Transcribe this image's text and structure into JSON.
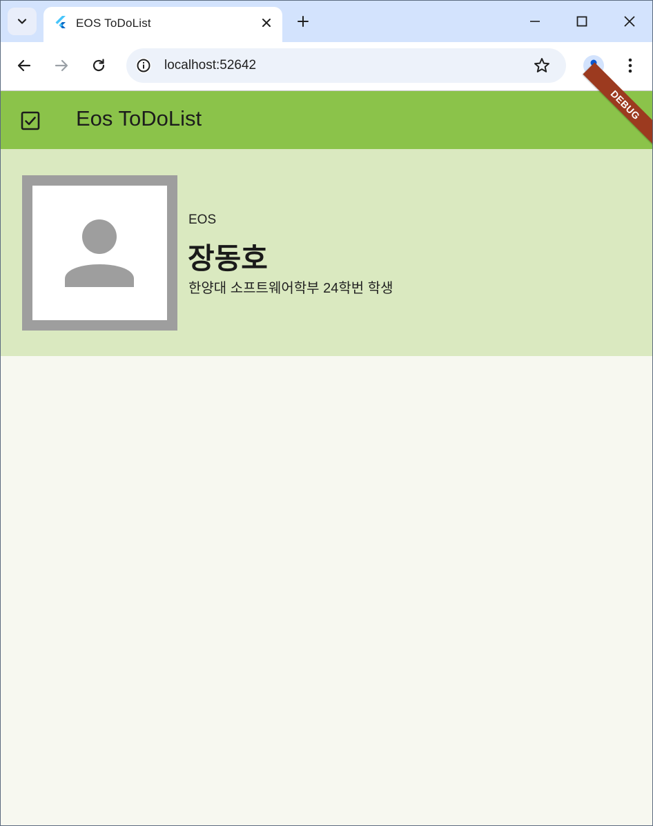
{
  "browser": {
    "tab_title": "EOS ToDoList",
    "url": "localhost:52642",
    "icons": {
      "tab_search": "chevron-down-icon",
      "favicon": "flutter-icon",
      "tab_close": "close-icon",
      "new_tab": "plus-icon",
      "minimize": "minimize-icon",
      "maximize": "maximize-icon",
      "window_close": "close-icon",
      "back": "arrow-back-icon",
      "forward": "arrow-forward-icon",
      "reload": "reload-icon",
      "site_info": "info-icon",
      "bookmark": "star-icon",
      "profile": "person-icon",
      "menu": "more-vert-icon"
    },
    "colors": {
      "tabstrip": "#d3e3fd",
      "omnibox": "#edf2fa"
    }
  },
  "app": {
    "title": "Eos ToDoList",
    "leading_icon": "check-box-icon",
    "debug_banner": "DEBUG",
    "colors": {
      "appbar": "#8bc34a",
      "card": "#dae9c0",
      "background": "#f7f8f0",
      "debug": "#9c3a1f"
    }
  },
  "profile": {
    "avatar_icon": "person-icon",
    "org": "EOS",
    "name": "장동호",
    "description": "한양대 소프트웨어학부 24학번 학생"
  }
}
